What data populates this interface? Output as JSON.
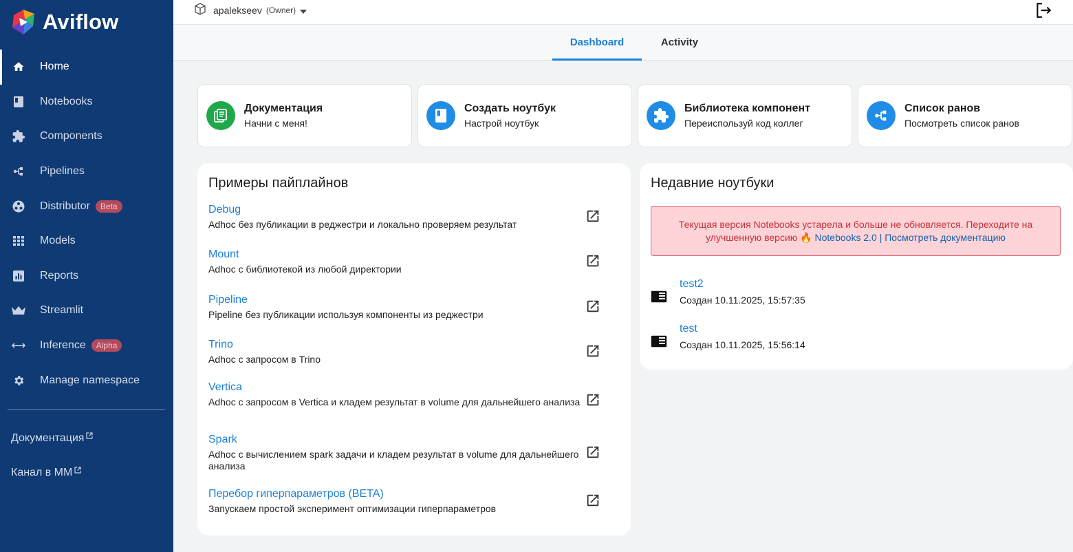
{
  "app": {
    "name": "Aviflow"
  },
  "sidebar": {
    "items": [
      {
        "label": "Home",
        "icon": "home-icon",
        "active": true
      },
      {
        "label": "Notebooks",
        "icon": "notebook-icon"
      },
      {
        "label": "Components",
        "icon": "puzzle-icon"
      },
      {
        "label": "Pipelines",
        "icon": "pipeline-icon"
      },
      {
        "label": "Distributor",
        "icon": "distributor-icon",
        "badge": "Beta"
      },
      {
        "label": "Models",
        "icon": "grid-icon"
      },
      {
        "label": "Reports",
        "icon": "chart-icon"
      },
      {
        "label": "Streamlit",
        "icon": "crown-icon"
      },
      {
        "label": "Inference",
        "icon": "arrows-icon",
        "badge": "Alpha"
      },
      {
        "label": "Manage namespace",
        "icon": "gear-icon"
      }
    ],
    "links": [
      {
        "label": "Документация"
      },
      {
        "label": "Канал в ММ"
      }
    ]
  },
  "header": {
    "namespace": "apalekseev",
    "role": "(Owner)"
  },
  "tabs": [
    {
      "label": "Dashboard",
      "active": true
    },
    {
      "label": "Activity"
    }
  ],
  "quick_cards": [
    {
      "title": "Документация",
      "subtitle": "Начни с меня!",
      "color": "#1ea84a",
      "icon": "docs-icon"
    },
    {
      "title": "Создать ноутбук",
      "subtitle": "Настрой ноутбук",
      "color": "#1f8ce6",
      "icon": "notebook-icon"
    },
    {
      "title": "Библиотека компонент",
      "subtitle": "Переиспользуй код коллег",
      "color": "#1f8ce6",
      "icon": "puzzle-icon"
    },
    {
      "title": "Список ранов",
      "subtitle": "Посмотреть список ранов",
      "color": "#1f8ce6",
      "icon": "pipeline-icon"
    }
  ],
  "examples": {
    "title": "Примеры пайплайнов",
    "items": [
      {
        "title": "Debug",
        "desc": "Adhoc без публикации в реджестри и локально проверяем результат"
      },
      {
        "title": "Mount",
        "desc": "Adhoc с библиотекой из любой директории"
      },
      {
        "title": "Pipeline",
        "desc": "Pipeline без публикации используя компоненты из реджестри"
      },
      {
        "title": "Trino",
        "desc": "Adhoc с запросом в Trino"
      },
      {
        "title": "Vertica",
        "desc": "Adhoc с запросом в Vertica и кладем результат в volume для дальнейшего анализа"
      },
      {
        "title": "Spark",
        "desc": "Adhoc с вычислением spark задачи и кладем результат в volume для дальнейшего анализа"
      },
      {
        "title": "Перебор гиперпараметров (BETA)",
        "desc": "Запускаем простой эксперимент оптимизации гиперпараметров"
      }
    ]
  },
  "recent": {
    "title": "Недавние ноутбуки",
    "warning": {
      "text": "Текущая версия Notebooks устарела и больше не обновляется. Переходите на улучшенную версию 🔥",
      "link1": "Notebooks 2.0",
      "sep": "|",
      "link2": "Посмотреть документацию"
    },
    "items": [
      {
        "name": "test2",
        "date": "Создан 10.11.2025, 15:57:35"
      },
      {
        "name": "test",
        "date": "Создан 10.11.2025, 15:56:14"
      }
    ]
  },
  "colors": {
    "sidebar": "#0f3a73",
    "accent": "#1a7fd6",
    "warning_bg": "#fcd3d6",
    "warning_text": "#c9303c"
  }
}
